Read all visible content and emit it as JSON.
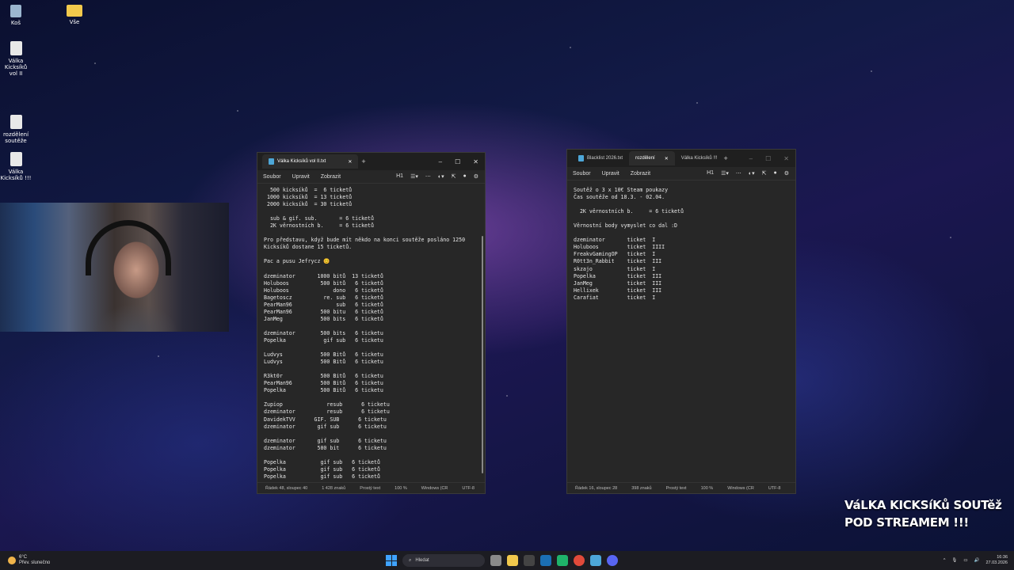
{
  "desktop_icons": [
    {
      "label": "Koš",
      "kind": "bin"
    },
    {
      "label": "Vše",
      "kind": "folder"
    },
    {
      "label": "Válka Kicksíků vol II",
      "kind": "file"
    },
    {
      "label": "rozdělení soutěže",
      "kind": "file"
    },
    {
      "label": "Válka Kicksíků !!!",
      "kind": "file"
    }
  ],
  "left_window": {
    "tabs": [
      {
        "label": "Válka Kicksíků vol II.txt",
        "active": true
      }
    ],
    "menu": [
      "Soubor",
      "Upravit",
      "Zobrazit"
    ],
    "heading": "H1",
    "lines": [
      "  500 kicksíků  =  6 ticketů",
      " 1000 kicksíků  = 13 ticketů",
      " 2000 kicksíků  = 30 ticketů",
      "",
      "  sub & gif. sub.       = 6 ticketů",
      "  2K věrnostních b.     = 6 ticketů",
      "",
      "Pro představu, když bude mít někdo na konci soutěže posláno 1250",
      "Kicksíků dostane 15 ticketů.",
      "",
      "Pac a pusu Jefrycz 😊",
      "",
      "dzeminator       1000 bitů  13 ticketů",
      "Holuboos          500 bitů   6 ticketů",
      "Holuboos              dono   6 ticketů",
      "Bagetoscz          re. sub   6 ticketů",
      "PearMan96              sub   6 ticketů",
      "PearMan96         500 bitu   6 ticketů",
      "JanMeg            500 bits   6 ticketů",
      "",
      "dzeminator        500 bits   6 ticketu",
      "Popelka            gif sub   6 ticketu",
      "",
      "Ludvys            500 Bitů   6 ticketu",
      "Ludvys            500 Bitů   6 ticketu",
      "",
      "R3kt0r            500 Bitů   6 ticketu",
      "PearMan96         500 Bitů   6 ticketu",
      "Popelka           500 Bitů   6 ticketu",
      "",
      "Zupiop              resub      6 ticketu",
      "dzeminator          resub      6 ticketu",
      "DavidekTVV      GIF. SUB      6 ticketu",
      "dzeminator       gif sub      6 ticketu",
      "",
      "dzeminator       gif sub      6 ticketu",
      "dzeminator       500 bit      6 ticketu",
      "",
      "Popelka           gif sub   6 ticketů",
      "Popelka           gif sub   6 ticketů",
      "Popelka           gif sub   6 ticketů"
    ],
    "status": [
      "Řádek 48, sloupec 40",
      "1 428 znaků",
      "Prostý text",
      "100 %",
      "Windows (CR",
      "UTF-8"
    ]
  },
  "right_window": {
    "tabs": [
      {
        "label": "Blacklist 2026.txt",
        "active": false
      },
      {
        "label": "rozdělení",
        "active": true
      },
      {
        "label": "Válka Kicksíků !!!",
        "active": false
      }
    ],
    "menu": [
      "Soubor",
      "Upravit",
      "Zobrazit"
    ],
    "heading": "H1",
    "lines": [
      "Soutěž o 3 x 10€ Steam poukazy",
      "Čas soutěže od 18.3. - 02.04.",
      "",
      "  2K věrnostních b.     = 6 ticketů",
      "",
      "Věrnostní body vymyslet co dal :D",
      "",
      "dzeminator       ticket  I",
      "Holuboos         ticket  IIII",
      "FreakvGamingOP   ticket  I",
      "R0tt3n_Rabbit    ticket  III",
      "skzajo           ticket  I",
      "Popelka          ticket  III",
      "JanMeg           ticket  III",
      "Hellixek         ticket  III",
      "Carafiat         ticket  I"
    ],
    "status": [
      "Řádek 16, sloupec 28",
      "398 znaků",
      "Prostý text",
      "100 %",
      "Windows (CR",
      "UTF-8"
    ]
  },
  "overlay": [
    "VáLKA KICKSíKů SOUTěž",
    "POD STREAMEM !!!"
  ],
  "taskbar": {
    "weather_temp": "6°C",
    "weather_text": "Přev. slunečno",
    "search_placeholder": "Hledat",
    "time": "16:36",
    "date": "27.03.2026"
  }
}
